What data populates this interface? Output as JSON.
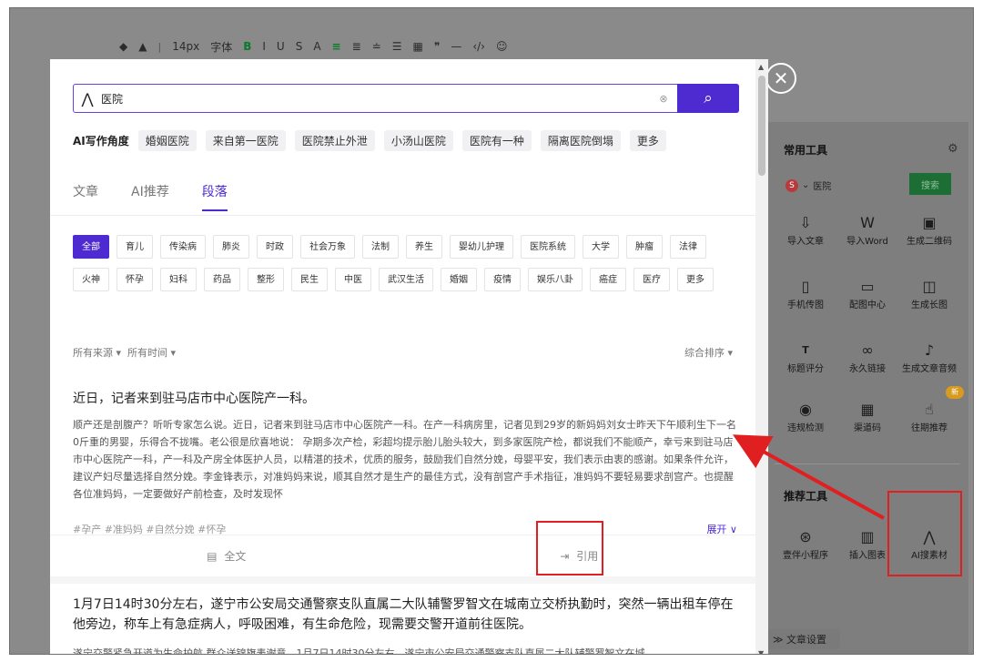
{
  "editor_toolbar": {
    "font_size": "14px",
    "font_family": "字体",
    "items": [
      "B",
      "I",
      "U",
      "S",
      "A"
    ]
  },
  "search": {
    "query": "医院",
    "clear_icon": "clear-icon",
    "search_icon": "search-icon"
  },
  "ai_angles": {
    "label": "AI写作角度",
    "chips": [
      "婚姻医院",
      "来自第一医院",
      "医院禁止外泄",
      "小汤山医院",
      "医院有一种",
      "隔离医院倒塌",
      "更多"
    ]
  },
  "tabs": [
    "文章",
    "AI推荐",
    "段落"
  ],
  "active_tab": "段落",
  "categories": [
    "全部",
    "育儿",
    "传染病",
    "肺炎",
    "时政",
    "社会万象",
    "法制",
    "养生",
    "婴幼儿护理",
    "医院系统",
    "大学",
    "肿瘤",
    "法律",
    "火神",
    "怀孕",
    "妇科",
    "药品",
    "整形",
    "民生",
    "中医",
    "武汉生活",
    "婚姻",
    "疫情",
    "娱乐八卦",
    "癌症",
    "医疗",
    "更多"
  ],
  "filters": {
    "source": "所有来源 ▾",
    "time": "所有时间 ▾",
    "sort": "综合排序 ▾"
  },
  "articles": [
    {
      "title": "近日，记者来到驻马店市中心医院产一科。",
      "body": "顺产还是剖腹产？听听专家怎么说。近日，记者来到驻马店市中心医院产一科。在产一科病房里，记者见到29岁的新妈妈刘女士昨天下午顺利生下一名0斤重的男婴，乐得合不拢嘴。老公很是欣喜地说： 孕期多次产检，彩超均提示胎儿胎头较大，到多家医院产检，都说我们不能顺产，幸亏来到驻马店市中心医院产一科，产一科及产房全体医护人员，以精湛的技术，优质的服务，鼓励我们自然分娩，母婴平安，我们表示由衷的感谢。如果条件允许，建议产妇尽量选择自然分娩。李金锋表示，对准妈妈来说，顺其自然才是生产的最佳方式，没有剖宫产手术指征，准妈妈不要轻易要求剖宫产。也提醒各位准妈妈，一定要做好产前检查，及时发现怀",
      "tags": "#孕产 #准妈妈 #自然分娩 #怀孕",
      "expand": "展开 ∨",
      "full_text": "全文",
      "cite": "引用"
    },
    {
      "title": "1月7日14时30分左右，遂宁市公安局交通警察支队直属二大队辅警罗智文在城南立交桥执勤时，突然一辆出租车停在他旁边，称车上有急症病人，呼吸困难，有生命危险，现需要交警开道前往医院。",
      "body": "遂宁交警紧急开道为生命护航 群众送锦旗表谢意。1月7日14时30分左右，遂宁市公安局交通警察支队直属二大队辅警罗智文在城"
    }
  ],
  "sidebar": {
    "common_title": "常用工具",
    "source_label": "医院",
    "search_btn": "搜索",
    "tools": [
      "导入文章",
      "导入Word",
      "生成二维码",
      "手机传图",
      "配图中心",
      "生成长图",
      "标题评分",
      "永久链接",
      "生成文章音频",
      "违规检测",
      "渠道码",
      "往期推荐"
    ],
    "new_badge": "新",
    "rec_title": "推荐工具",
    "rec_tools": [
      "壹伴小程序",
      "插入图表",
      "AI搜素材"
    ],
    "settings": "文章设置"
  },
  "accent_color": "#4d2bd1",
  "highlight_color": "#e02020"
}
